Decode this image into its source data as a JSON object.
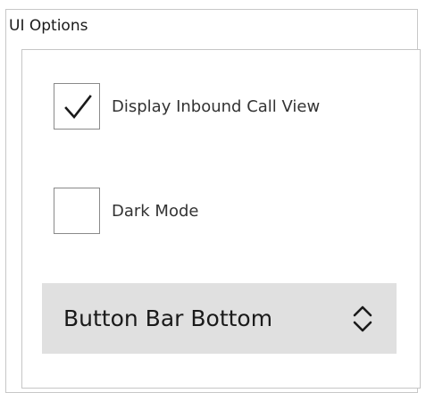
{
  "group": {
    "title": "UI Options"
  },
  "options": [
    {
      "label": "Display Inbound Call View",
      "checked": true
    },
    {
      "label": "Dark Mode",
      "checked": false
    }
  ],
  "button_bar": {
    "selected_value": "Button Bar Bottom",
    "icon": "up-down-chevron-icon"
  },
  "colors": {
    "select_background": "#e0e0e0",
    "checkbox_border": "#8a8a8a"
  }
}
